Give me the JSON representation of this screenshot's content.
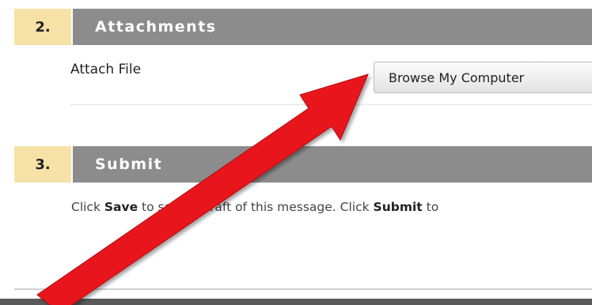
{
  "sections": [
    {
      "number": "2.",
      "title": "Attachments"
    },
    {
      "number": "3.",
      "title": "Submit"
    }
  ],
  "attachments": {
    "field_label": "Attach File",
    "browse_button_label": "Browse My Computer"
  },
  "submit": {
    "text_1": "Click ",
    "save_word": "Save",
    "text_2": " to save a draft of this message. Click ",
    "submit_word": "Submit",
    "text_3": " to"
  },
  "annotation": {
    "arrow_color": "#e8141a"
  }
}
